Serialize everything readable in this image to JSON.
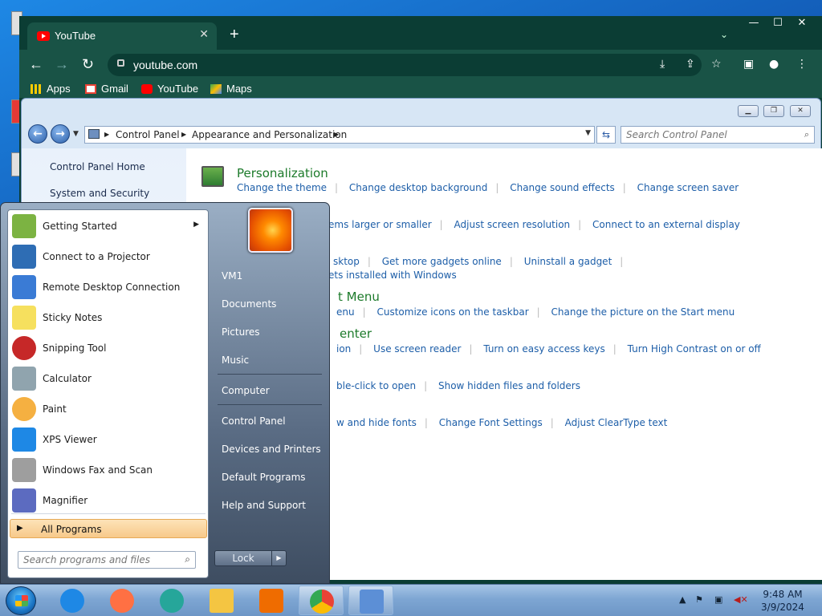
{
  "chrome": {
    "tab_title": "YouTube",
    "tab_close": "✕",
    "new_tab": "+",
    "url": "youtube.com",
    "bookmarks": [
      "Apps",
      "Gmail",
      "YouTube",
      "Maps"
    ],
    "window_buttons": [
      "—",
      "☐",
      "✕"
    ]
  },
  "control_panel": {
    "breadcrumb": [
      "Control Panel",
      "Appearance and Personalization"
    ],
    "search_placeholder": "Search Control Panel",
    "sidebar": [
      "Control Panel Home",
      "System and Security"
    ],
    "categories": [
      {
        "title": "Personalization",
        "links": [
          "Change the theme",
          "Change desktop background",
          "Change sound effects",
          "Change screen saver"
        ]
      },
      {
        "title": "",
        "links": [
          "ems larger or smaller",
          "Adjust screen resolution",
          "Connect to an external display"
        ]
      },
      {
        "title": "",
        "links": [
          "sktop",
          "Get more gadgets online",
          "Uninstall a gadget"
        ],
        "links2": [
          "ets installed with Windows"
        ]
      },
      {
        "title": "t Menu",
        "links": [
          "enu",
          "Customize icons on the taskbar",
          "Change the picture on the Start menu"
        ]
      },
      {
        "title": "enter",
        "links": [
          "ion",
          "Use screen reader",
          "Turn on easy access keys",
          "Turn High Contrast on or off"
        ]
      },
      {
        "title": "",
        "links": [
          "ble-click to open",
          "Show hidden files and folders"
        ]
      },
      {
        "title": "",
        "links": [
          "w and hide fonts",
          "Change Font Settings",
          "Adjust ClearType text"
        ]
      }
    ]
  },
  "start_menu": {
    "programs": [
      {
        "label": "Getting Started",
        "icon": "getting-started-icon",
        "color": "#7cb342",
        "submenu": true
      },
      {
        "label": "Connect to a Projector",
        "icon": "projector-icon",
        "color": "#2e6db4"
      },
      {
        "label": "Remote Desktop Connection",
        "icon": "remote-desktop-icon",
        "color": "#3a7bd5"
      },
      {
        "label": "Sticky Notes",
        "icon": "sticky-notes-icon",
        "color": "#f6e05e"
      },
      {
        "label": "Snipping Tool",
        "icon": "scissors-icon",
        "color": "#c62828"
      },
      {
        "label": "Calculator",
        "icon": "calculator-icon",
        "color": "#90a4ae"
      },
      {
        "label": "Paint",
        "icon": "paint-icon",
        "color": "#f5b041"
      },
      {
        "label": "XPS Viewer",
        "icon": "xps-viewer-icon",
        "color": "#1e88e5"
      },
      {
        "label": "Windows Fax and Scan",
        "icon": "fax-icon",
        "color": "#9e9e9e"
      },
      {
        "label": "Magnifier",
        "icon": "magnifier-icon",
        "color": "#5c6bc0"
      }
    ],
    "all_programs": "All Programs",
    "search_placeholder": "Search programs and files",
    "right_items": [
      "VM1",
      "Documents",
      "Pictures",
      "Music",
      "Computer",
      "Control Panel",
      "Devices and Printers",
      "Default Programs",
      "Help and Support"
    ],
    "lock": "Lock"
  },
  "taskbar": {
    "apps": [
      {
        "name": "internet-explorer",
        "color": "#1e88e5"
      },
      {
        "name": "firefox",
        "color": "#ff7043"
      },
      {
        "name": "edge",
        "color": "#26a69a"
      },
      {
        "name": "file-explorer",
        "color": "#f4c542"
      },
      {
        "name": "media-player",
        "color": "#ef6c00"
      },
      {
        "name": "chrome",
        "color": "#4caf50"
      },
      {
        "name": "control-panel",
        "color": "#5c8fd6"
      }
    ],
    "time": "9:48 AM",
    "date": "3/9/2024"
  }
}
